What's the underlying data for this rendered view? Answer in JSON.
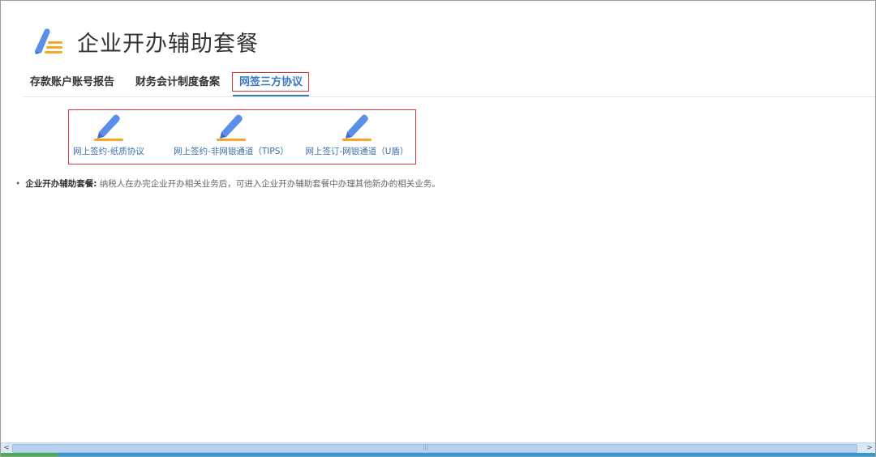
{
  "header": {
    "title": "企业开办辅助套餐",
    "icon": "package-list-icon"
  },
  "tabs": [
    {
      "label": "存款账户账号报告",
      "active": false
    },
    {
      "label": "财务会计制度备案",
      "active": false
    },
    {
      "label": "网签三方协议",
      "active": true
    }
  ],
  "cards": [
    {
      "label": "网上签约-纸质协议",
      "icon": "pen-sign-icon"
    },
    {
      "label": "网上签约-非网银通道（TIPS）",
      "icon": "pen-sign-icon"
    },
    {
      "label": "网上签订-网银通道（U盾）",
      "icon": "pen-sign-icon"
    }
  ],
  "note": {
    "bullet": "•",
    "title": "企业开办辅助套餐:",
    "text": " 纳税人在办完企业开办相关业务后，可进入企业开办辅助套餐中办理其他新办的相关业务。"
  },
  "scrollbar": {
    "left_arrow": "<",
    "right_arrow": ">",
    "grip": "|||"
  },
  "colors": {
    "accent": "#3a78c2",
    "highlight_border": "#d9363e",
    "pen_blue": "#5b8ee8",
    "pen_orange": "#f5a623"
  }
}
